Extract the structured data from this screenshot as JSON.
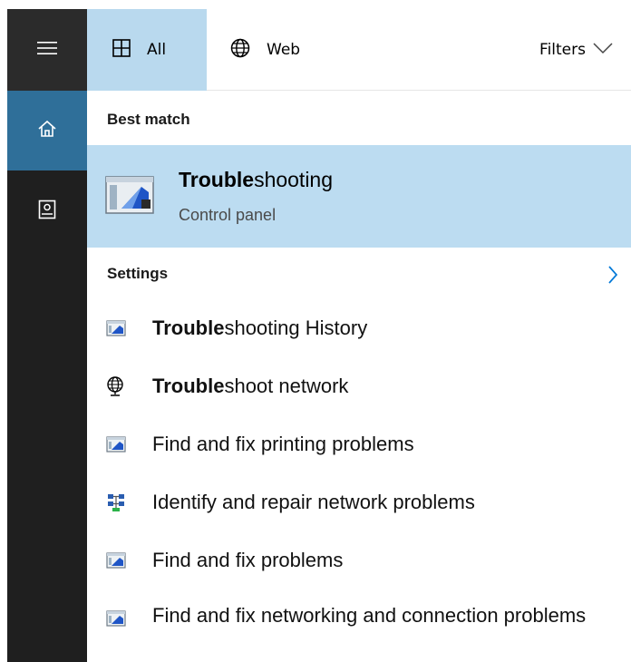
{
  "tabs": {
    "all_label": "All",
    "web_label": "Web",
    "filters_label": "Filters"
  },
  "best_match": {
    "section_title": "Best match",
    "title_bold": "Trouble",
    "title_rest": "shooting",
    "subtitle": "Control panel"
  },
  "settings": {
    "section_title": "Settings",
    "items": [
      {
        "bold": "Trouble",
        "rest": "shooting History",
        "icon": "control-panel-icon"
      },
      {
        "bold": "Trouble",
        "rest": "shoot network",
        "icon": "network-globe-icon"
      },
      {
        "bold": "",
        "rest": "Find and fix printing problems",
        "icon": "control-panel-icon"
      },
      {
        "bold": "",
        "rest": "Identify and repair network problems",
        "icon": "network-diagnostics-icon"
      },
      {
        "bold": "",
        "rest": "Find and fix problems",
        "icon": "control-panel-icon"
      },
      {
        "bold": "",
        "rest": "Find and fix networking and connection problems",
        "icon": "control-panel-icon"
      }
    ]
  },
  "colors": {
    "rail": "#1f1f1f",
    "rail_active": "#2f6f99",
    "tab_active": "#b9d9ee",
    "selected_row": "#bcdcf1",
    "accent": "#0078d7"
  }
}
